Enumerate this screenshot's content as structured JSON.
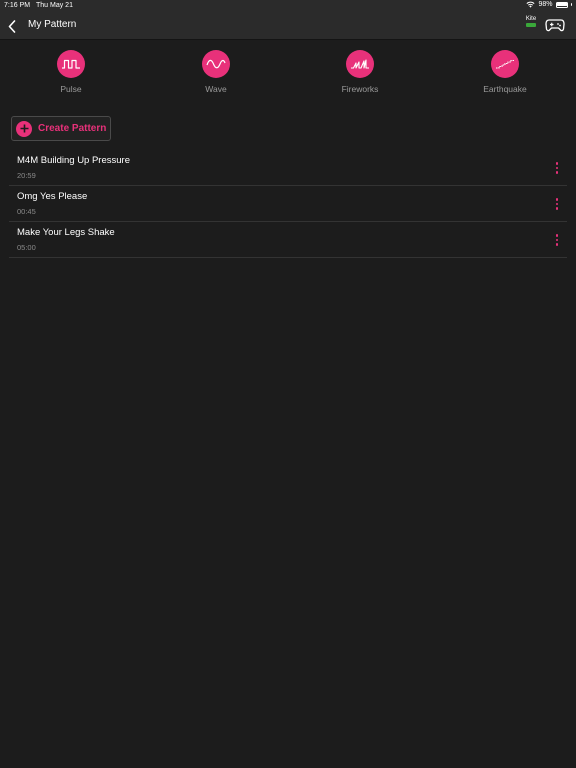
{
  "status_bar": {
    "time": "7:16 PM",
    "date": "Thu May 21",
    "battery_pct": "98%",
    "battery_level": 0.98
  },
  "nav": {
    "title": "My Pattern",
    "device_name": "Kite"
  },
  "presets": [
    {
      "label": "Pulse",
      "icon": "pulse-wave-icon"
    },
    {
      "label": "Wave",
      "icon": "sine-wave-icon"
    },
    {
      "label": "Fireworks",
      "icon": "fireworks-wave-icon"
    },
    {
      "label": "Earthquake",
      "icon": "earthquake-wave-icon"
    }
  ],
  "create_button": {
    "label": "Create Pattern"
  },
  "patterns": [
    {
      "title": "M4M Building Up Pressure",
      "duration": "20:59"
    },
    {
      "title": "Omg Yes Please",
      "duration": "00:45"
    },
    {
      "title": "Make Your Legs Shake",
      "duration": "05:00"
    }
  ],
  "colors": {
    "accent": "#e8317a",
    "background": "#1c1c1c",
    "bar": "#2b2b2b",
    "device_battery": "#3aa83a"
  }
}
